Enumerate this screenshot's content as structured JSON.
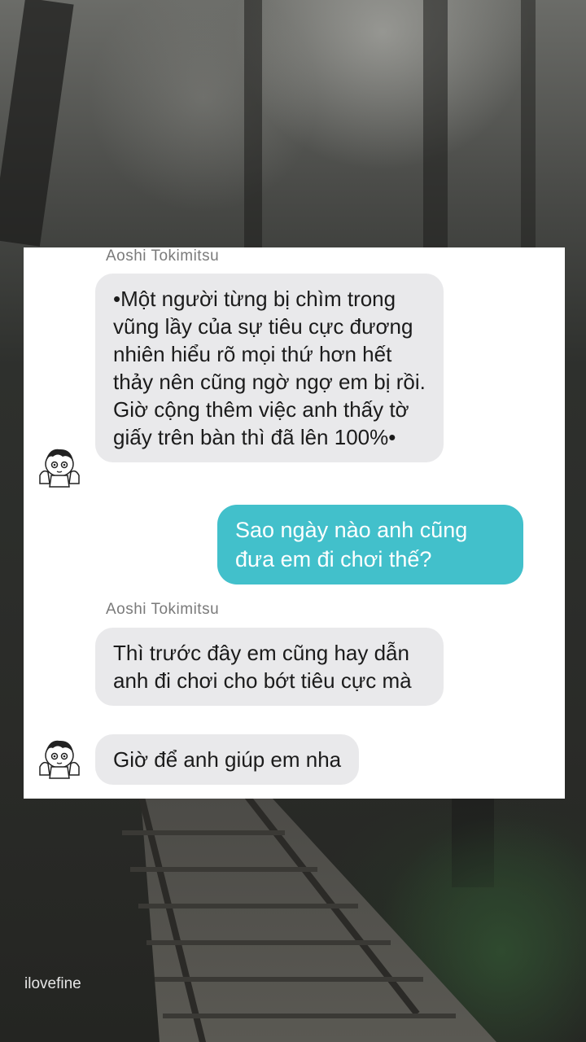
{
  "chat": {
    "messages": [
      {
        "type": "sender",
        "text": "Aoshi Tokimitsu"
      },
      {
        "type": "incoming",
        "text": "•Một người từng bị chìm trong vũng lầy của sự tiêu cực đương nhiên hiểu rõ mọi thứ hơn hết thảy nên cũng ngờ ngợ em bị rồi. Giờ cộng thêm việc anh thấy tờ giấy trên bàn thì đã lên 100%•"
      },
      {
        "type": "outgoing",
        "text": "Sao ngày nào anh cũng đưa em đi chơi thế?"
      },
      {
        "type": "sender",
        "text": "Aoshi Tokimitsu"
      },
      {
        "type": "incoming",
        "text": "Thì trước đây em cũng hay dẫn anh đi chơi cho bớt tiêu cực mà"
      },
      {
        "type": "incoming",
        "text": "Giờ để anh giúp em nha"
      }
    ],
    "avatar_icon": "anime-boy-avatar-icon"
  },
  "watermark": "ilovefine",
  "colors": {
    "incoming_bubble": "#e9e9eb",
    "outgoing_bubble": "#42c0cb",
    "card_background": "#ffffff"
  }
}
